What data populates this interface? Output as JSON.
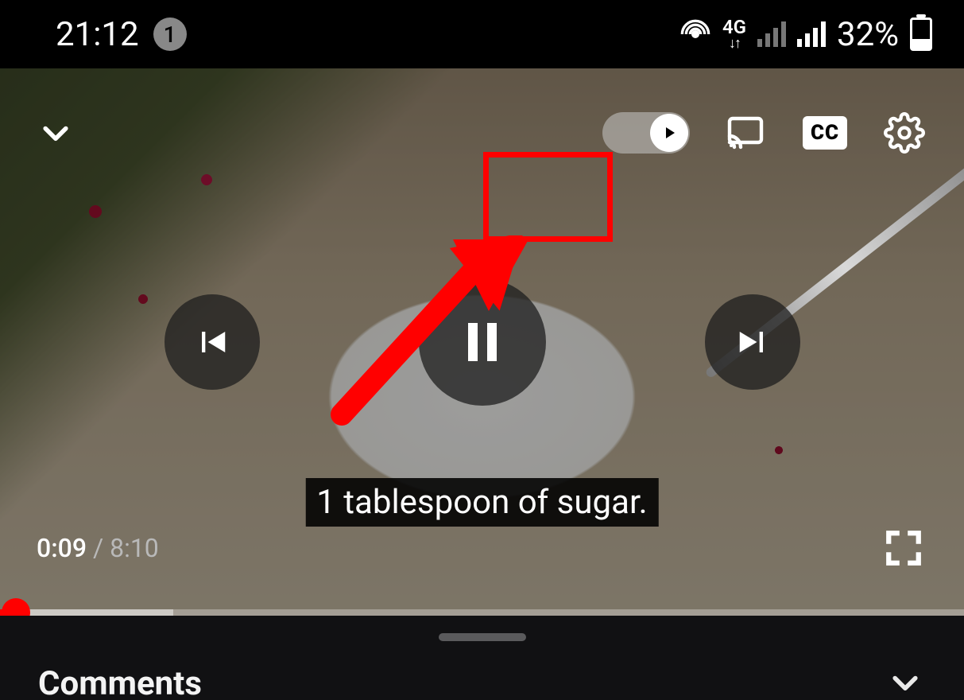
{
  "status_bar": {
    "time": "21:12",
    "notification_count": "1",
    "network_label": "4G",
    "battery_percent": "32%"
  },
  "player": {
    "caption_text": "1 tablespoon of sugar.",
    "current_time": "0:09",
    "duration": "8:10",
    "cc_label": "CC"
  },
  "below": {
    "comments_heading": "Comments"
  }
}
